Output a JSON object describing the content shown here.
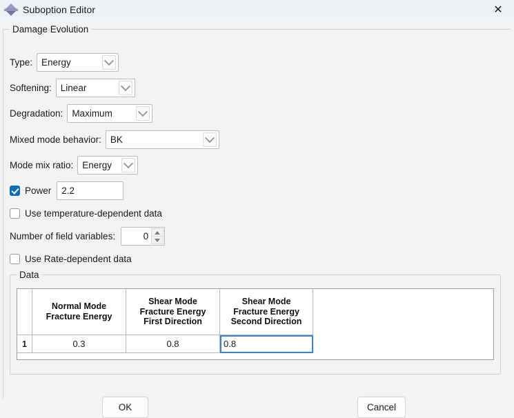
{
  "window": {
    "title": "Suboption Editor",
    "icon": "abaqus-diamond-icon",
    "close_label": "✕"
  },
  "damage_group": {
    "legend": "Damage Evolution",
    "fields": [
      {
        "label": "Type:",
        "value": "Energy",
        "control": "combobox"
      },
      {
        "label": "Softening:",
        "value": "Linear",
        "control": "combobox"
      },
      {
        "label": "Degradation:",
        "value": "Maximum",
        "control": "combobox"
      },
      {
        "label": "Mixed mode behavior:",
        "value": "BK",
        "control": "combobox"
      },
      {
        "label": "Mode mix ratio:",
        "value": "Energy",
        "control": "combobox"
      }
    ],
    "power": {
      "label": "Power",
      "checked": true,
      "value": "2.2"
    },
    "temperature_dependent": {
      "label": "Use temperature-dependent data",
      "checked": false
    },
    "field_variables": {
      "label": "Number of field variables:",
      "value": "0"
    },
    "rate_dependent": {
      "label": "Use Rate-dependent data",
      "checked": false
    }
  },
  "data_group": {
    "legend": "Data",
    "table": {
      "columns": [
        "Normal Mode\nFracture Energy",
        "Shear Mode\nFracture Energy\nFirst Direction",
        "Shear Mode\nFracture Energy\nSecond Direction"
      ],
      "columns_lines": [
        [
          "Normal Mode",
          "Fracture Energy"
        ],
        [
          "Shear Mode",
          "Fracture Energy",
          "First Direction"
        ],
        [
          "Shear Mode",
          "Fracture Energy",
          "Second Direction"
        ]
      ],
      "rows": [
        {
          "index": "1",
          "values": [
            "0.3",
            "0.8",
            "0.8"
          ]
        }
      ],
      "selected_cell": {
        "row": 0,
        "col": 2
      }
    }
  },
  "footer": {
    "ok_label": "OK",
    "cancel_label": "Cancel"
  },
  "colors": {
    "titlebar_bg": "#eef2f6",
    "dialog_bg": "#f3f3f3",
    "accent_checkbox": "#0f6cbd",
    "selection_outline": "#3c84c8",
    "icon_purple": "#8a86bd"
  }
}
